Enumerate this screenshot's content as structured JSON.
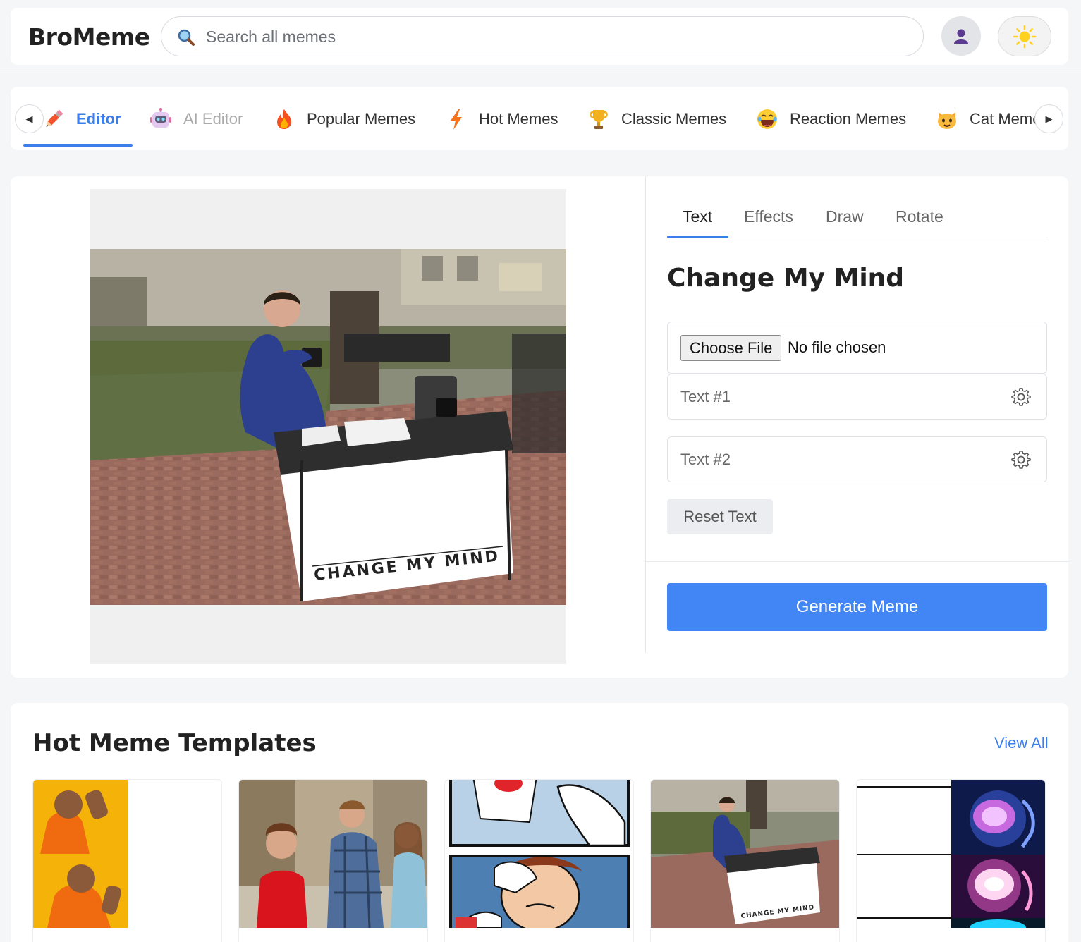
{
  "header": {
    "brand": "BroMeme",
    "search_placeholder": "Search all memes",
    "user_icon": "user-icon",
    "theme_icon": "sun-icon"
  },
  "nav": {
    "items": [
      {
        "label": "Editor",
        "icon": "pencil-icon",
        "active": true
      },
      {
        "label": "AI Editor",
        "icon": "robot-icon"
      },
      {
        "label": "Popular Memes",
        "icon": "fire-icon"
      },
      {
        "label": "Hot Memes",
        "icon": "lightning-icon"
      },
      {
        "label": "Classic Memes",
        "icon": "trophy-icon"
      },
      {
        "label": "Reaction Memes",
        "icon": "laughing-face-icon"
      },
      {
        "label": "Cat Memes",
        "icon": "cat-icon"
      }
    ],
    "prev_arrow": "◀",
    "next_arrow": "▶"
  },
  "editor": {
    "meme_caption": "CHANGE MY MIND",
    "tabs": [
      "Text",
      "Effects",
      "Draw",
      "Rotate"
    ],
    "active_tab": "Text",
    "title": "Change My Mind",
    "file_button": "Choose File",
    "file_status": "No file chosen",
    "text1_placeholder": "Text #1",
    "text2_placeholder": "Text #2",
    "reset_label": "Reset Text",
    "generate_label": "Generate Meme"
  },
  "templates": {
    "title": "Hot Meme Templates",
    "view_all": "View All",
    "items": [
      "Drake Hotline Bling",
      "Distracted Boyfriend",
      "Two Buttons",
      "Change My Mind",
      "Expanding Brain"
    ],
    "card4_caption": "CHANGE MY MIND"
  },
  "colors": {
    "accent": "#3b7dea",
    "primary_button": "#4285f4",
    "background": "#f5f6f8"
  }
}
